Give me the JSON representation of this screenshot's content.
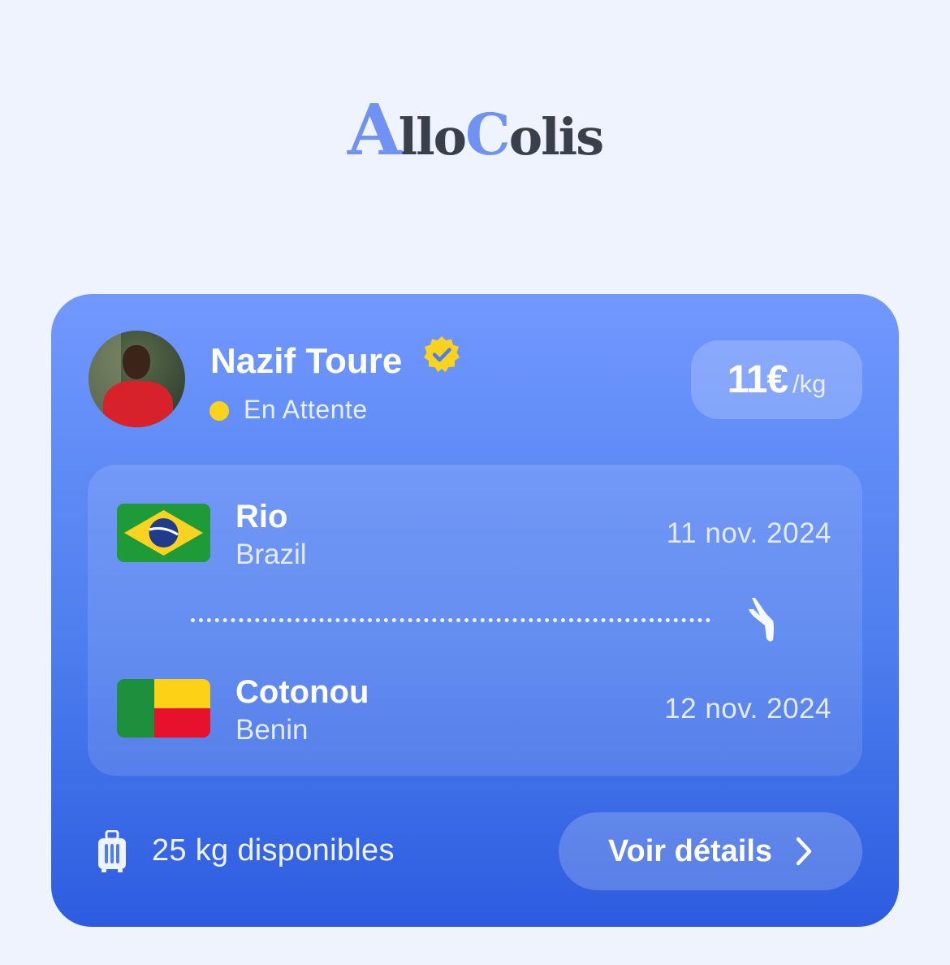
{
  "brand": {
    "first_letter": "A",
    "part1": "llo",
    "second_letter": "C",
    "part2": "olis"
  },
  "trip_card": {
    "traveler": {
      "name": "Nazif Toure",
      "verified_icon": "verified-badge-icon",
      "status": "En Attente",
      "status_color": "#fbd31e"
    },
    "price": {
      "amount": "11€",
      "unit": "/kg"
    },
    "route": {
      "origin": {
        "city": "Rio",
        "country": "Brazil",
        "date": "11 nov. 2024",
        "flag_icon": "brazil-flag-icon"
      },
      "destination": {
        "city": "Cotonou",
        "country": "Benin",
        "date": "12 nov. 2024",
        "flag_icon": "benin-flag-icon"
      },
      "transport_icon": "airplane-icon"
    },
    "capacity": {
      "icon": "luggage-icon",
      "text": "25 kg disponibles"
    },
    "details_button": {
      "label": "Voir détails",
      "icon": "chevron-right-icon"
    }
  },
  "colors": {
    "background": "#eff3fe",
    "card_top": "#7198fe",
    "card_bottom": "#2d5ce0",
    "brand_accent": "#6f92f3",
    "brand_dark": "#3a3f4c"
  }
}
